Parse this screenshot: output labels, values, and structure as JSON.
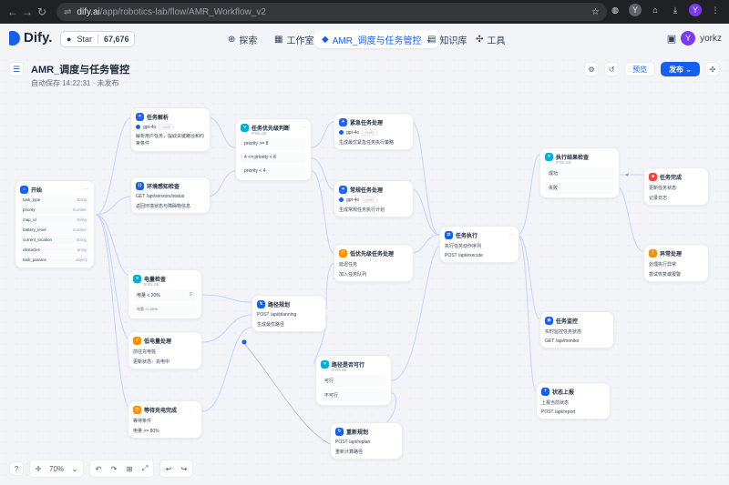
{
  "browser": {
    "url_host": "dify.ai",
    "url_path": "/app/robotics-lab/flow/AMR_Workflow_v2",
    "profile_initial": "Y"
  },
  "header": {
    "logo_text": "Dify.",
    "star_label": "Star",
    "star_count": "67,676",
    "tabs": [
      {
        "label": "探索",
        "icon": "compass-icon"
      },
      {
        "label": "工作室",
        "icon": "studio-icon"
      },
      {
        "label": "AMR_调度与任务管控",
        "icon": "app-icon"
      },
      {
        "label": "知识库",
        "icon": "book-icon"
      },
      {
        "label": "工具",
        "icon": "tools-icon"
      }
    ],
    "user_initial": "Y",
    "user_name": "yorkz"
  },
  "workflow": {
    "title": "AMR_调度与任务管控",
    "status": "自动保存 14:22:31 · 未发布",
    "preview_label": "预览",
    "publish_label": "发布"
  },
  "nodes": {
    "start": {
      "title": "开始",
      "vars": [
        {
          "name": "task_type",
          "type": "string"
        },
        {
          "name": "priority",
          "type": "number"
        },
        {
          "name": "map_id",
          "type": "string"
        },
        {
          "name": "battery_level",
          "type": "number"
        },
        {
          "name": "current_location",
          "type": "string"
        },
        {
          "name": "obstacles",
          "type": "array"
        },
        {
          "name": "task_params",
          "type": "object"
        }
      ]
    },
    "parse": {
      "title": "任务解析",
      "model": "gpt-4o",
      "mode": "CHAT",
      "desc": "解析用户任务，提取关键路径和约束条件"
    },
    "env": {
      "title": "环境感知检查",
      "line1": "GET /api/sensors/status",
      "line2": "返回环境状态与障碍物信息"
    },
    "prio": {
      "title": "任务优先级判断",
      "sub": "IF/ELSE",
      "cases": [
        "priority >= 8",
        "4 <= priority < 8",
        "priority < 4"
      ]
    },
    "urgent": {
      "title": "紧急任务处理",
      "model": "gpt-4o",
      "mode": "CHAT",
      "desc": "生成最优紧急任务执行策略"
    },
    "normal": {
      "title": "常规任务处理",
      "model": "gpt-4o",
      "mode": "CHAT",
      "desc": "生成常规任务执行计划"
    },
    "low": {
      "title": "低优先级任务处理",
      "line1": "延迟任务",
      "line2": "加入任务队列"
    },
    "exec": {
      "title": "任务执行",
      "line1": "执行任务动作序列",
      "line2": "POST /api/execute"
    },
    "result": {
      "title": "执行结果检查",
      "sub": "IF/ELSE",
      "cases": [
        "成功",
        "失败"
      ]
    },
    "done": {
      "title": "任务完成",
      "line1": "更新任务状态",
      "line2": "记录日志"
    },
    "error": {
      "title": "异常处理",
      "line1": "处理执行异常",
      "line2": "尝试恢复或报警"
    },
    "battery": {
      "title": "电量检查",
      "sub": "IF/ELSE",
      "cases": [
        "电量 < 20%",
        "电量 >= 20%"
      ]
    },
    "lowbat": {
      "title": "低电量处理",
      "line1": "前往充电桩",
      "line2": "更新状态：充电中"
    },
    "wait": {
      "title": "等待充电完成",
      "line1": "等待条件",
      "line2": "电量 >= 80%"
    },
    "path": {
      "title": "路径规划",
      "line1": "POST /api/planning",
      "line2": "生成最优路径"
    },
    "feasible": {
      "title": "路径是否可行",
      "sub": "IF/ELSE",
      "cases": [
        "可行",
        "不可行"
      ]
    },
    "replan": {
      "title": "重新规划",
      "line1": "POST /api/replan",
      "line2": "重新计算路径"
    },
    "monitor": {
      "title": "任务监控",
      "line1": "实时监控任务状态",
      "line2": "GET /api/monitor"
    },
    "report": {
      "title": "状态上报",
      "line1": "上报当前状态",
      "line2": "POST /api/report"
    }
  },
  "bottom": {
    "zoom": "70%",
    "help": "?"
  },
  "colors": {
    "accent": "#155eef",
    "llm": "#2563eb",
    "logic": "#06aed4",
    "http": "#f79009",
    "code": "#155eef",
    "end": "#f04438"
  }
}
